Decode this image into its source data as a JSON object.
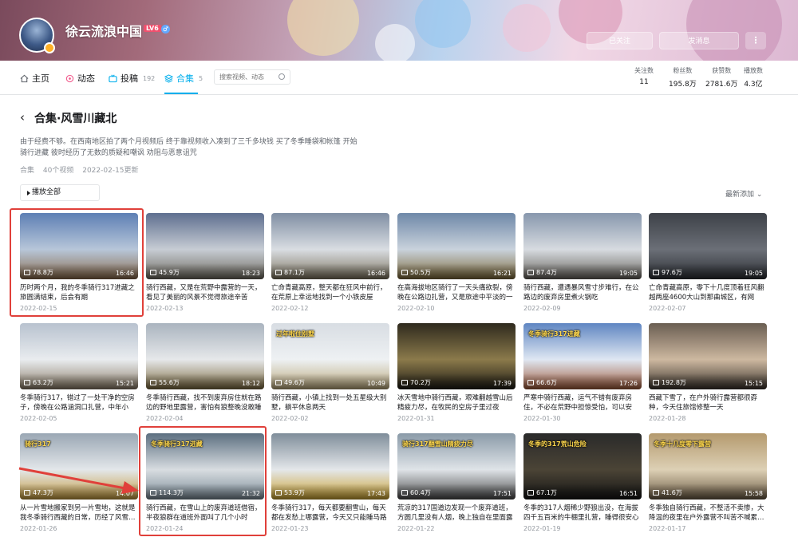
{
  "header": {
    "username": "徐云流浪中国",
    "level": "LV6",
    "follow_label": "已关注",
    "message_label": "发消息",
    "more_label": "⋮"
  },
  "nav": {
    "items": [
      {
        "label": "主页",
        "count": ""
      },
      {
        "label": "动态",
        "count": ""
      },
      {
        "label": "投稿",
        "count": "192"
      },
      {
        "label": "合集",
        "count": "5"
      }
    ],
    "search_placeholder": "搜索视频、动态",
    "stats": [
      {
        "label": "关注数",
        "value": "11"
      },
      {
        "label": "粉丝数",
        "value": "195.8万"
      },
      {
        "label": "获赞数",
        "value": "2781.6万"
      },
      {
        "label": "播放数",
        "value": "4.3亿"
      }
    ]
  },
  "collection": {
    "title": "合集·风雪川藏北",
    "description": "由于经费不够。在西南地区拍了两个月视频后 终于靠视频收入凑到了三千多块钱 买了冬季睡袋和帐篷 开始骑行进藏 彼时经历了无数的质疑和嘲讽 劝阻与恶意诅咒",
    "meta_type": "合集",
    "meta_count": "40个视频",
    "meta_updated": "2022-02-15更新",
    "play_all": "播放全部",
    "sort_label": "最新添加 ⌄"
  },
  "videos": [
    {
      "title": "历时两个月，我的冬季骑行317进藏之旅圆满结束，后会有期",
      "views": "78.8万",
      "duration": "16:46",
      "date": "2022-02-15",
      "overlay": ""
    },
    {
      "title": "骑行西藏，又是在荒野中露营的一天，看见了美丽的风景不觉得旅途辛苦",
      "views": "45.9万",
      "duration": "18:23",
      "date": "2022-02-13",
      "overlay": ""
    },
    {
      "title": "亡命青藏高原，整天都在狂风中前行，在荒原上幸运地找到一个小铁皮屋",
      "views": "87.1万",
      "duration": "16:46",
      "date": "2022-02-12",
      "overlay": ""
    },
    {
      "title": "在高海拔地区骑行了一天头痛欲裂，傍晚在公路边扎营，又是旅途中平淡的一天",
      "views": "50.5万",
      "duration": "16:21",
      "date": "2022-02-10",
      "overlay": ""
    },
    {
      "title": "骑行西藏，遭遇暴风雪寸步难行，在公路边的废弃房里煮火锅吃",
      "views": "87.4万",
      "duration": "19:05",
      "date": "2022-02-09",
      "overlay": ""
    },
    {
      "title": "亡命青藏高原，零下十几度顶着狂风翻越两座4600大山到那曲城区，有网友…",
      "views": "97.6万",
      "duration": "19:05",
      "date": "2022-02-07",
      "overlay": ""
    },
    {
      "title": "冬季骑行317，错过了一处干净的空房子，傍晚在公路涵洞口扎营，中年小伙…",
      "views": "63.2万",
      "duration": "15:21",
      "date": "2022-02-05",
      "overlay": ""
    },
    {
      "title": "冬季骑行西藏，找不到废弃房住就在路边的野地里露营，害怕有狼整晚没敢睡",
      "views": "55.6万",
      "duration": "18:12",
      "date": "2022-02-04",
      "overlay": ""
    },
    {
      "title": "骑行西藏，小镇上找到一处五星级大别墅，躺平休息两天",
      "views": "49.6万",
      "duration": "10:49",
      "date": "2022-02-02",
      "overlay": "过年啦住别墅"
    },
    {
      "title": "冰天雪地中骑行西藏，艰难翻越雪山后精疲力尽，在牧民的空房子里过夜",
      "views": "70.2万",
      "duration": "17:39",
      "date": "2022-01-31",
      "overlay": ""
    },
    {
      "title": "严寒中骑行西藏，运气不错有废弃房住，不必在荒野中担惊受怕，可以安心…",
      "views": "66.6万",
      "duration": "17:26",
      "date": "2022-01-30",
      "overlay": "冬季骑行317进藏"
    },
    {
      "title": "西藏下雪了，在户外骑行露营都很孬种，今天住旅馆修整一天",
      "views": "192.8万",
      "duration": "15:15",
      "date": "2022-01-28",
      "overlay": ""
    },
    {
      "title": "从一片雪地搬家到另一片雪地，这就是我冬季骑行西藏的日常，历经了风雪…",
      "views": "47.3万",
      "duration": "14:07",
      "date": "2022-01-26",
      "overlay": "骑行317"
    },
    {
      "title": "骑行西藏，在雪山上的废弃道班借宿，半夜狼群在道班外面叫了几个小时",
      "views": "114.3万",
      "duration": "21:32",
      "date": "2022-01-24",
      "overlay": "冬季骑行317进藏"
    },
    {
      "title": "冬季骑行317，每天都要翻雪山，每天都在发愁上哪露营，今天又只能睡马路边",
      "views": "53.9万",
      "duration": "17:43",
      "date": "2022-01-23",
      "overlay": ""
    },
    {
      "title": "荒凉的317国道边发现一个废弃道班，方圆几里没有人烟，晚上独自在里面露营",
      "views": "60.4万",
      "duration": "17:51",
      "date": "2022-01-22",
      "overlay": "骑行317翻雪山精疲力尽"
    },
    {
      "title": "冬季的317人烟稀少野狼出没，在海拔四千五百米的牛棚里扎营，睡得很安心",
      "views": "67.1万",
      "duration": "16:51",
      "date": "2022-01-19",
      "overlay": "冬季的317荒山危险"
    },
    {
      "title": "冬季独自骑行西藏，不整活不卖惨，大降温的夜里在户外露营不叫苦不喊累…",
      "views": "41.6万",
      "duration": "15:58",
      "date": "2022-01-17",
      "overlay": "冬季十几度零下露营"
    }
  ],
  "colors": {
    "accent": "#00aeec",
    "highlight_box": "#e0403a"
  }
}
